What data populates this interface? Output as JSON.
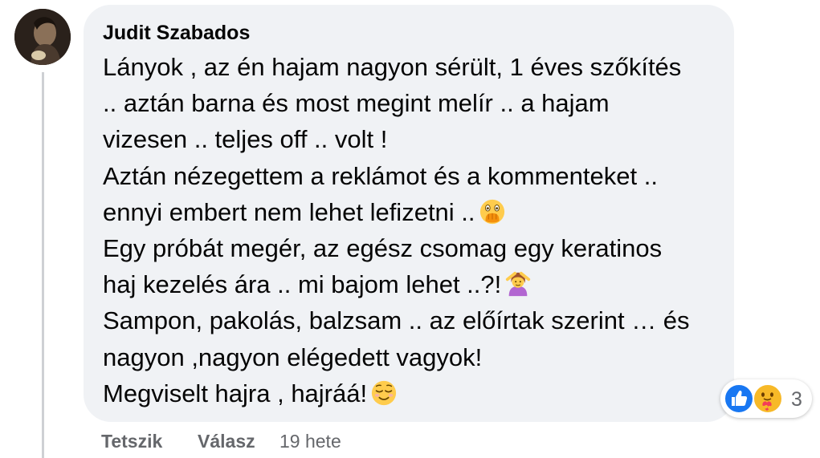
{
  "comment": {
    "author": "Judit Szabados",
    "lines": [
      "Lányok , az én hajam nagyon sérült, 1 éves szőkítés",
      ".. aztán barna és most megint melír .. a hajam",
      "vizesen .. teljes off .. volt !",
      "Aztán nézegettem a reklámot és a kommenteket ..",
      "ennyi embert nem lehet lefizetni ..",
      "Egy próbát megér, az egész csomag egy keratinos",
      "haj kezelés ára .. mi bajom lehet ..?!",
      "Sampon, pakolás, balzsam .. az előírtak szerint … és",
      "nagyon ,nagyon elégedett vagyok!",
      "Megviselt hajra , hajráá!"
    ],
    "emojis": {
      "line5": "face-with-open-eyes-and-hand-over-mouth-icon",
      "line7": "woman-gesturing-ok-icon",
      "line10": "relieved-face-icon"
    }
  },
  "reactions": {
    "icons": [
      "like-icon",
      "care-icon"
    ],
    "count": "3"
  },
  "actions": {
    "like_label": "Tetszik",
    "reply_label": "Válasz",
    "timestamp": "19 hete"
  },
  "colors": {
    "bubble_background": "#f0f2f5",
    "text": "#050505",
    "secondary_text": "#65676b",
    "like_blue": "#1877f2",
    "care_yellow": "#f7b928"
  }
}
